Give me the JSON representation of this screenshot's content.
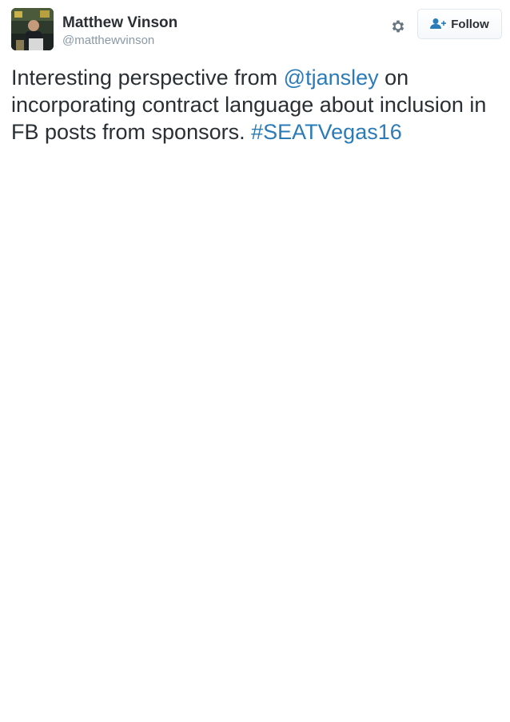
{
  "author": {
    "display_name": "Matthew Vinson",
    "screen_name": "@matthewvinson",
    "avatar": "profile-photo"
  },
  "actions": {
    "settings_icon": "gear-icon",
    "follow_icon": "add-user-icon",
    "follow_label": "Follow"
  },
  "tweet": {
    "text_before_mention": "Interesting perspective from ",
    "mention": "@tjansley",
    "text_after_mention": " on incorporating contract language about inclusion in FB posts from sponsors. ",
    "hashtag": "#SEATVegas16"
  },
  "colors": {
    "link": "#2b7bb9",
    "text": "#292f33",
    "muted": "#8899a6",
    "icon": "#66757f"
  }
}
